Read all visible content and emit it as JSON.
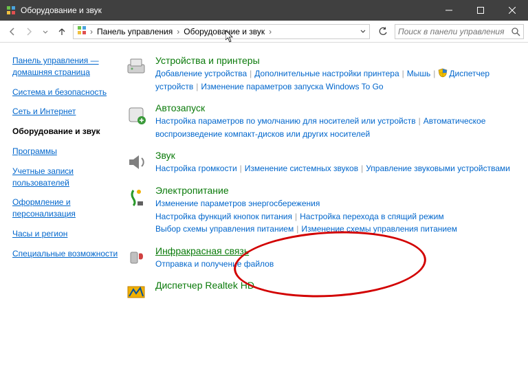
{
  "window": {
    "title": "Оборудование и звук"
  },
  "breadcrumb": {
    "root": "Панель управления",
    "current": "Оборудование и звук"
  },
  "search": {
    "placeholder": "Поиск в панели управления"
  },
  "sidebar": {
    "home": "Панель управления — домашняя страница",
    "items": [
      "Система и безопасность",
      "Сеть и Интернет",
      "Оборудование и звук",
      "Программы",
      "Учетные записи пользователей",
      "Оформление и персонализация",
      "Часы и регион",
      "Специальные возможности"
    ],
    "current_index": 2
  },
  "categories": [
    {
      "title": "Устройства и принтеры",
      "links": [
        "Добавление устройства",
        "Дополнительные настройки принтера",
        "Мышь",
        "Диспетчер устройств",
        "Изменение параметров запуска Windows To Go"
      ],
      "shielded": [
        3
      ]
    },
    {
      "title": "Автозапуск",
      "links": [
        "Настройка параметров по умолчанию для носителей или устройств",
        "Автоматическое воспроизведение компакт-дисков или других носителей"
      ]
    },
    {
      "title": "Звук",
      "links": [
        "Настройка громкости",
        "Изменение системных звуков",
        "Управление звуковыми устройствами"
      ]
    },
    {
      "title": "Электропитание",
      "links": [
        "Изменение параметров энергосбережения",
        "Настройка функций кнопок питания",
        "Настройка перехода в спящий режим",
        "Выбор схемы управления питанием",
        "Изменение схемы управления питанием"
      ]
    },
    {
      "title": "Инфракрасная связь",
      "links": [
        "Отправка и получение файлов"
      ]
    },
    {
      "title": "Диспетчер Realtek HD",
      "links": []
    }
  ]
}
